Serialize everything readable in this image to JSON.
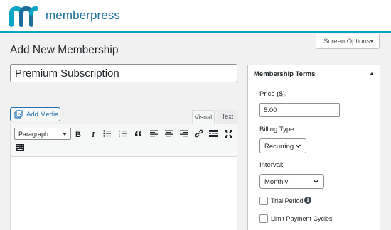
{
  "brand": {
    "name": "memberpress",
    "logo_icon": "memberpress-m-logo",
    "colors": {
      "logo_teal": "#06a5c3",
      "logo_blue": "#1b6f9a",
      "accent_line": "#06a5c3"
    }
  },
  "screen_options": {
    "label": "Screen Options",
    "icon": "caret-down-icon"
  },
  "page": {
    "title": "Add New Membership"
  },
  "title_field": {
    "value": "Premium Subscription"
  },
  "editor": {
    "add_media_label": "Add Media",
    "tabs": [
      {
        "label": "Visual",
        "active": true
      },
      {
        "label": "Text",
        "active": false
      }
    ],
    "format_select": "Paragraph",
    "toolbar_icons": [
      "bold-icon",
      "italic-icon",
      "bullet-list-icon",
      "numbered-list-icon",
      "blockquote-icon",
      "align-left-icon",
      "align-center-icon",
      "align-right-icon",
      "link-icon",
      "read-more-icon",
      "fullscreen-icon",
      "toolbar-toggle-icon"
    ]
  },
  "membership_terms": {
    "title": "Membership Terms",
    "price": {
      "label": "Price ($):",
      "value": "5.00"
    },
    "billing_type": {
      "label": "Billing Type:",
      "selected": "Recurring"
    },
    "interval": {
      "label": "Interval:",
      "selected": "Monthly"
    },
    "trial_period": {
      "label": "Trial Period",
      "checked": false
    },
    "limit_payment_cycles": {
      "label": "Limit Payment Cycles",
      "checked": false
    }
  }
}
